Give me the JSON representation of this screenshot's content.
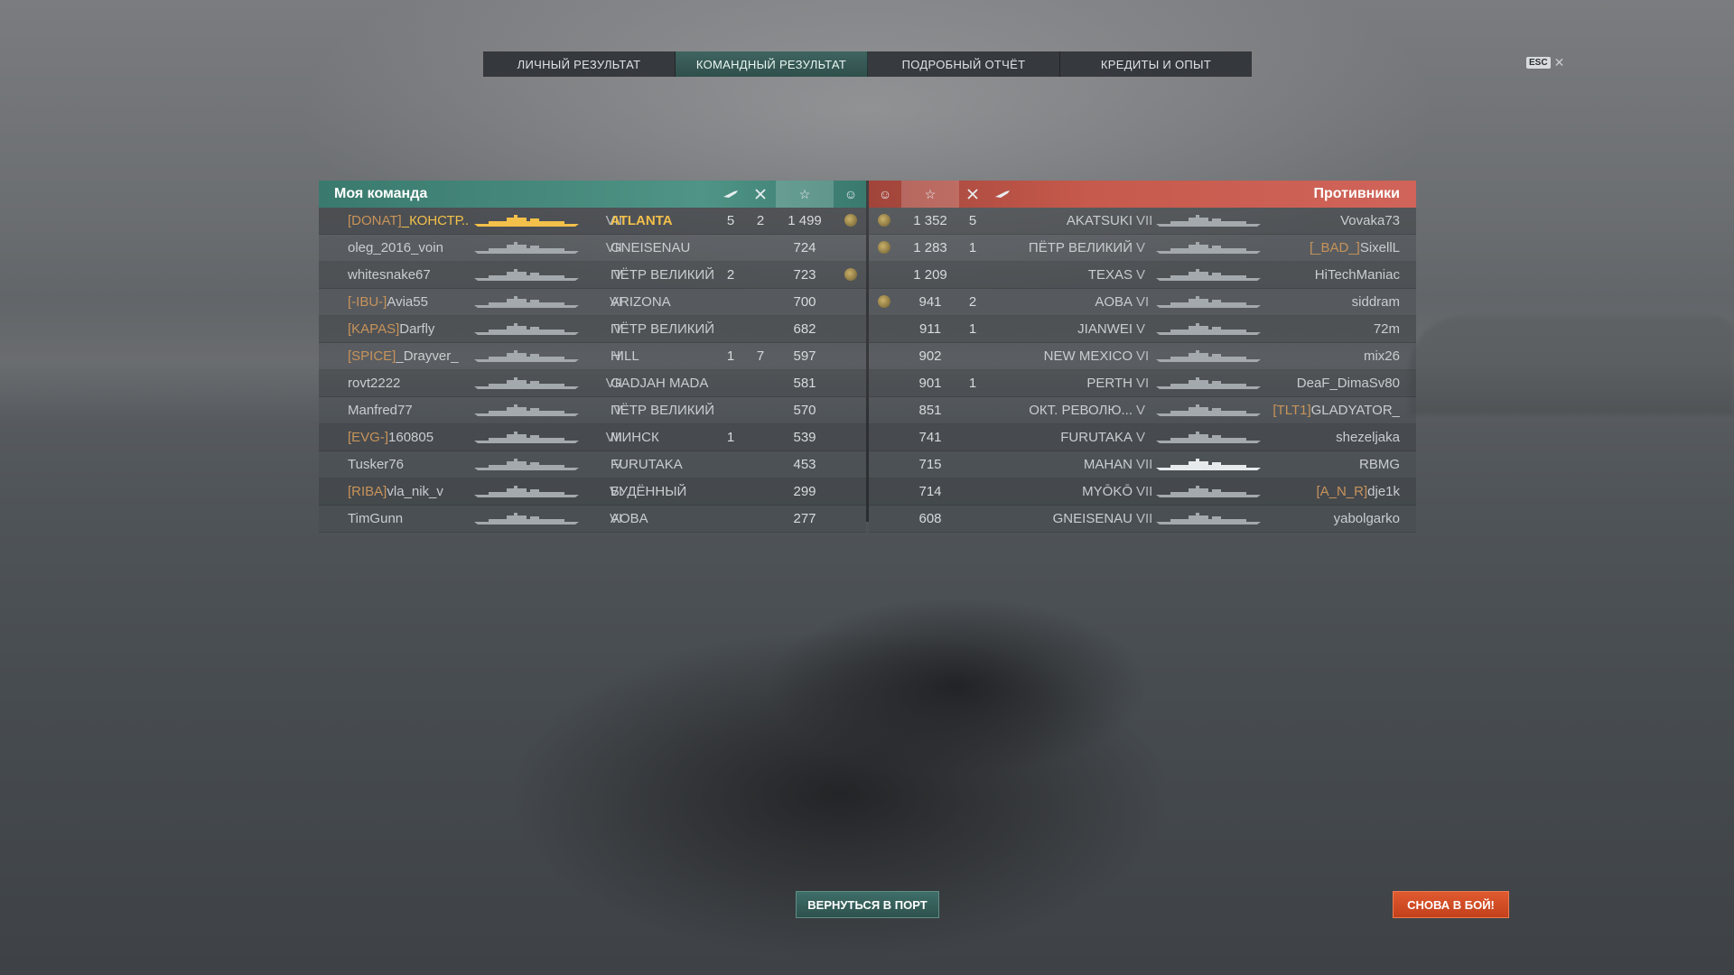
{
  "tabs": [
    {
      "label": "ЛИЧНЫЙ РЕЗУЛЬТАТ",
      "active": false
    },
    {
      "label": "КОМАНДНЫЙ РЕЗУЛЬТАТ",
      "active": true
    },
    {
      "label": "ПОДРОБНЫЙ ОТЧЁТ",
      "active": false
    },
    {
      "label": "КРЕДИТЫ И ОПЫТ",
      "active": false
    }
  ],
  "esc": {
    "key": "ESC",
    "close": "✕"
  },
  "my_team": {
    "title": "Моя команда",
    "header_icons": [
      "aircraft-icon",
      "kills-icon",
      "star-icon",
      "medal-icon"
    ],
    "rows": [
      {
        "clan": "[DONAT]",
        "name": "_КОНСТР...",
        "tier": "VII",
        "ship": "ATLANTA",
        "planes": "5",
        "kills": "2",
        "xp": "1 499",
        "medal": true,
        "me": true
      },
      {
        "clan": "",
        "name": "oleg_2016_voin",
        "tier": "VII",
        "ship": "GNEISENAU",
        "planes": "",
        "kills": "",
        "xp": "724",
        "medal": false
      },
      {
        "clan": "",
        "name": "whitesnake67",
        "tier": "V",
        "ship": "ПЁТР ВЕЛИКИЙ",
        "planes": "2",
        "kills": "",
        "xp": "723",
        "medal": true
      },
      {
        "clan": "[-IBU-]",
        "name": "Avia55",
        "tier": "VI",
        "ship": "ARIZONA",
        "planes": "",
        "kills": "",
        "xp": "700",
        "medal": false
      },
      {
        "clan": "[KAPAS]",
        "name": "Darfly",
        "tier": "V",
        "ship": "ПЁТР ВЕЛИКИЙ",
        "planes": "",
        "kills": "",
        "xp": "682",
        "medal": false
      },
      {
        "clan": "[SPICE]",
        "name": "_Drayver_",
        "tier": "V",
        "ship": "HILL",
        "planes": "1",
        "kills": "7",
        "xp": "597",
        "medal": false
      },
      {
        "clan": "",
        "name": "rovt2222",
        "tier": "VII",
        "ship": "GADJAH MADA",
        "planes": "",
        "kills": "",
        "xp": "581",
        "medal": false
      },
      {
        "clan": "",
        "name": "Manfred77",
        "tier": "V",
        "ship": "ПЁТР ВЕЛИКИЙ",
        "planes": "",
        "kills": "",
        "xp": "570",
        "medal": false
      },
      {
        "clan": "[EVG-]",
        "name": "160805",
        "tier": "VII",
        "ship": "МИНСК",
        "planes": "1",
        "kills": "",
        "xp": "539",
        "medal": false
      },
      {
        "clan": "",
        "name": "Tusker76",
        "tier": "V",
        "ship": "FURUTAKA",
        "planes": "",
        "kills": "",
        "xp": "453",
        "medal": false
      },
      {
        "clan": "[RIBA]",
        "name": "vla_nik_v",
        "tier": "VI",
        "ship": "БУДЁННЫЙ",
        "planes": "",
        "kills": "",
        "xp": "299",
        "medal": false
      },
      {
        "clan": "",
        "name": "TimGunn",
        "tier": "VI",
        "ship": "AOBA",
        "planes": "",
        "kills": "",
        "xp": "277",
        "medal": false
      }
    ]
  },
  "enemies": {
    "title": "Противники",
    "header_icons": [
      "medal-icon",
      "star-icon",
      "kills-icon",
      "aircraft-icon"
    ],
    "rows": [
      {
        "medal": true,
        "xp": "1 352",
        "kills": "5",
        "ship": "AKATSUKI",
        "tier": "VII",
        "clan": "",
        "name": "Vovaka73"
      },
      {
        "medal": true,
        "xp": "1 283",
        "kills": "1",
        "ship": "ПЁТР ВЕЛИКИЙ",
        "tier": "V",
        "clan": "[_BAD_]",
        "name": "SixellL"
      },
      {
        "medal": false,
        "xp": "1 209",
        "kills": "",
        "ship": "TEXAS",
        "tier": "V",
        "clan": "",
        "name": "HiTechManiac"
      },
      {
        "medal": true,
        "xp": "941",
        "kills": "2",
        "ship": "AOBA",
        "tier": "VI",
        "clan": "",
        "name": "siddram"
      },
      {
        "medal": false,
        "xp": "911",
        "kills": "1",
        "ship": "JIANWEI",
        "tier": "V",
        "clan": "",
        "name": "72m"
      },
      {
        "medal": false,
        "xp": "902",
        "kills": "",
        "ship": "NEW MEXICO",
        "tier": "VI",
        "clan": "",
        "name": "mix26"
      },
      {
        "medal": false,
        "xp": "901",
        "kills": "1",
        "ship": "PERTH",
        "tier": "VI",
        "clan": "",
        "name": "DeaF_DimaSv80"
      },
      {
        "medal": false,
        "xp": "851",
        "kills": "",
        "ship": "ОКТ. РЕВОЛЮ...",
        "tier": "V",
        "clan": "[TLT1]",
        "name": "GLADYATOR_"
      },
      {
        "medal": false,
        "xp": "741",
        "kills": "",
        "ship": "FURUTAKA",
        "tier": "V",
        "clan": "",
        "name": "shezeljaka"
      },
      {
        "medal": false,
        "xp": "715",
        "kills": "",
        "ship": "MAHAN",
        "tier": "VII",
        "clan": "",
        "name": "RBMG"
      },
      {
        "medal": false,
        "xp": "714",
        "kills": "",
        "ship": "MYŌKŌ",
        "tier": "VII",
        "clan": "[A_N_R]",
        "name": "dje1k"
      },
      {
        "medal": false,
        "xp": "608",
        "kills": "",
        "ship": "GNEISENAU",
        "tier": "VII",
        "clan": "",
        "name": "yabolgarko"
      }
    ]
  },
  "buttons": {
    "port": "ВЕРНУТЬСЯ В ПОРТ",
    "battle": "СНОВА В БОЙ!"
  }
}
